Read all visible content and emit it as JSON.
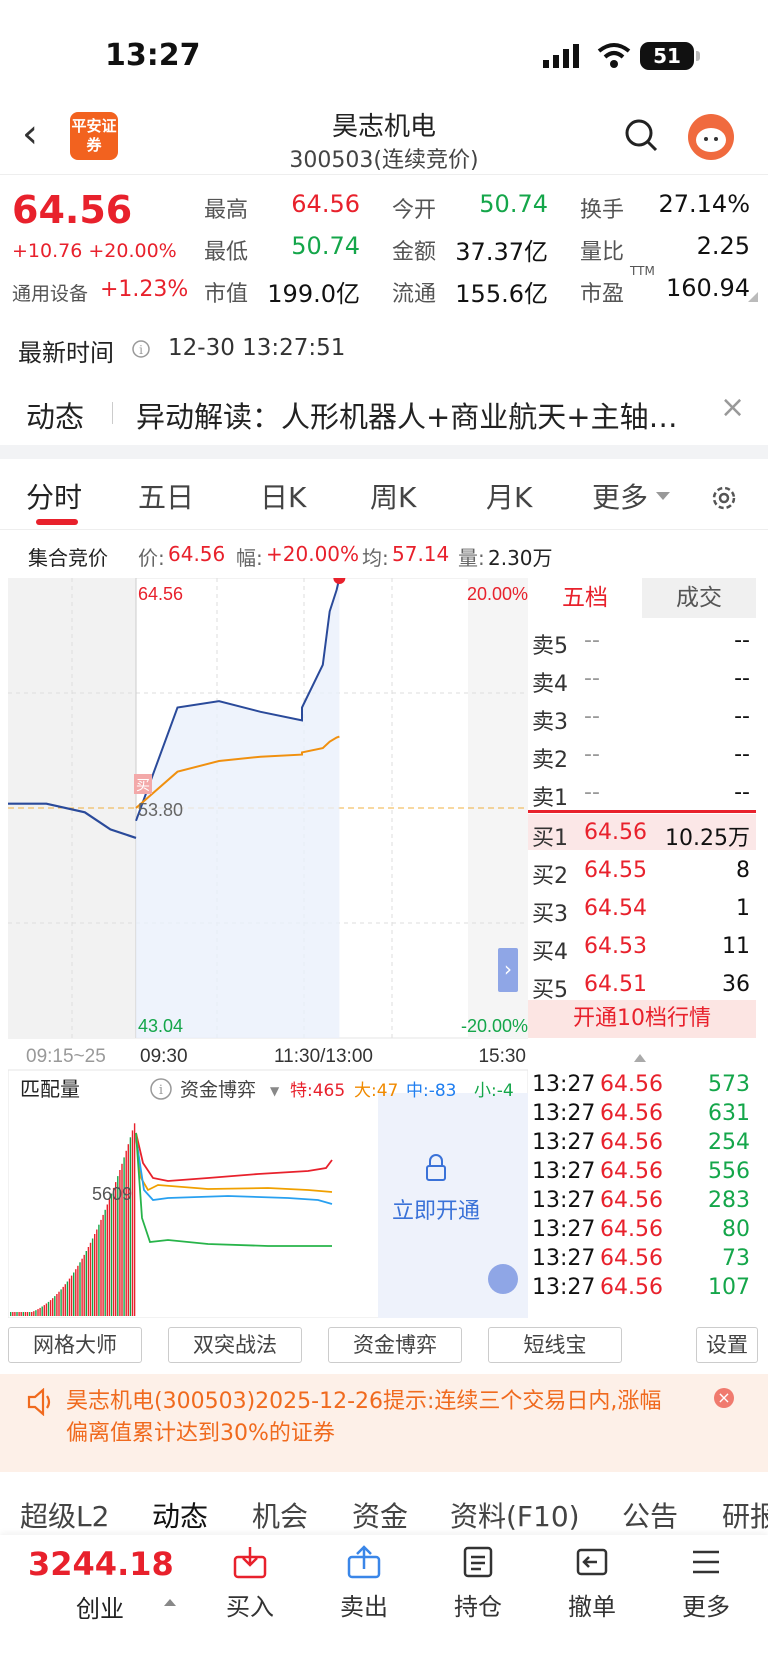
{
  "status": {
    "time": "13:27",
    "battery": "51"
  },
  "header": {
    "logo": "平安证券",
    "title": "昊志机电",
    "subtitle": "300503(连续竞价)"
  },
  "quote": {
    "price": "64.56",
    "change": "+10.76 +20.00%",
    "sector": "通用设备",
    "sector_change": "+1.23%",
    "fields": [
      {
        "label": "最高",
        "value": "64.56",
        "color": "red"
      },
      {
        "label": "今开",
        "value": "50.74",
        "color": "green"
      },
      {
        "label": "换手",
        "value": "27.14%",
        "color": "black"
      },
      {
        "label": "最低",
        "value": "50.74",
        "color": "green"
      },
      {
        "label": "金额",
        "value": "37.37亿",
        "color": "black"
      },
      {
        "label": "量比",
        "value": "2.25",
        "color": "black"
      },
      {
        "label": "市值",
        "value": "199.0亿",
        "color": "black"
      },
      {
        "label": "流通",
        "value": "155.6亿",
        "color": "black"
      },
      {
        "label": "市盈",
        "value": "160.94",
        "color": "black"
      }
    ],
    "pe_sup": "TTM"
  },
  "update": {
    "label": "最新时间",
    "time": "12-30 13:27:51"
  },
  "news": {
    "tag": "动态",
    "text": "异动解读：人形机器人+商业航天+主轴…"
  },
  "tabs": [
    "分时",
    "五日",
    "日K",
    "周K",
    "月K",
    "更多"
  ],
  "auction": {
    "label": "集合竞价",
    "price_label": "价:",
    "price": "64.56",
    "amp_label": "幅:",
    "amp": "+20.00%",
    "avg_label": "均:",
    "avg": "57.14",
    "vol_label": "量:",
    "vol": "2.30万"
  },
  "chart": {
    "max_price": "64.56",
    "max_pct": "20.00%",
    "min_price": "43.04",
    "min_pct": "-20.00%",
    "ref_price": "53.80",
    "buy_mark": "买",
    "times": [
      "09:15~25",
      "09:30",
      "11:30/13:00",
      "15:30"
    ],
    "sub_label": "匹配量",
    "sub_tool": "资金博弈",
    "sub_value": "5609",
    "flows": [
      {
        "label": "特:",
        "value": "465"
      },
      {
        "label": "大:",
        "value": "47"
      },
      {
        "label": "中:",
        "value": "-83"
      },
      {
        "label": "小:",
        "value": "-4"
      }
    ],
    "unlock": "立即开通"
  },
  "chart_data": {
    "type": "line",
    "x": [
      "09:30",
      "10:00",
      "10:30",
      "11:00",
      "11:30",
      "13:00",
      "13:15",
      "13:20",
      "13:25",
      "13:27"
    ],
    "series": [
      {
        "name": "价",
        "values": [
          53.2,
          58.5,
          58.8,
          58.3,
          57.9,
          58.5,
          60.5,
          63.0,
          64.0,
          64.56
        ]
      },
      {
        "name": "均",
        "values": [
          53.8,
          55.5,
          56.0,
          56.2,
          56.3,
          56.4,
          56.6,
          56.9,
          57.1,
          57.14
        ]
      }
    ],
    "pre_x": [
      "09:15",
      "09:18",
      "09:21",
      "09:23",
      "09:25"
    ],
    "pre_values": [
      54.0,
      54.0,
      53.6,
      52.8,
      52.4
    ],
    "ylim": [
      43.04,
      64.56
    ]
  },
  "depth": {
    "tabs": [
      "五档",
      "成交"
    ],
    "sell": [
      {
        "label": "卖5",
        "price": "--",
        "vol": "--"
      },
      {
        "label": "卖4",
        "price": "--",
        "vol": "--"
      },
      {
        "label": "卖3",
        "price": "--",
        "vol": "--"
      },
      {
        "label": "卖2",
        "price": "--",
        "vol": "--"
      },
      {
        "label": "卖1",
        "price": "--",
        "vol": "--"
      }
    ],
    "buy": [
      {
        "label": "买1",
        "price": "64.56",
        "vol": "10.25万"
      },
      {
        "label": "买2",
        "price": "64.55",
        "vol": "8"
      },
      {
        "label": "买3",
        "price": "64.54",
        "vol": "1"
      },
      {
        "label": "买4",
        "price": "64.53",
        "vol": "11"
      },
      {
        "label": "买5",
        "price": "64.51",
        "vol": "36"
      }
    ],
    "upgrade": "开通10档行情",
    "ticks": [
      {
        "t": "13:27",
        "p": "64.56",
        "v": "573"
      },
      {
        "t": "13:27",
        "p": "64.56",
        "v": "631"
      },
      {
        "t": "13:27",
        "p": "64.56",
        "v": "254"
      },
      {
        "t": "13:27",
        "p": "64.56",
        "v": "556"
      },
      {
        "t": "13:27",
        "p": "64.56",
        "v": "283"
      },
      {
        "t": "13:27",
        "p": "64.56",
        "v": "80"
      },
      {
        "t": "13:27",
        "p": "64.56",
        "v": "73"
      },
      {
        "t": "13:27",
        "p": "64.56",
        "v": "107"
      }
    ]
  },
  "tools": [
    "网格大师",
    "双突战法",
    "资金博弈",
    "短线宝",
    "设置"
  ],
  "notice": "昊志机电(300503)2025-12-26提示:连续三个交易日内,涨幅偏离值累计达到30%的证券",
  "bottom_tabs": [
    "超级L2",
    "动态",
    "机会",
    "资金",
    "资料(F10)",
    "公告",
    "研报"
  ],
  "bottom": {
    "index_value": "3244.18",
    "index_name": "创业",
    "actions": [
      "买入",
      "卖出",
      "持仓",
      "撤单",
      "更多"
    ]
  }
}
